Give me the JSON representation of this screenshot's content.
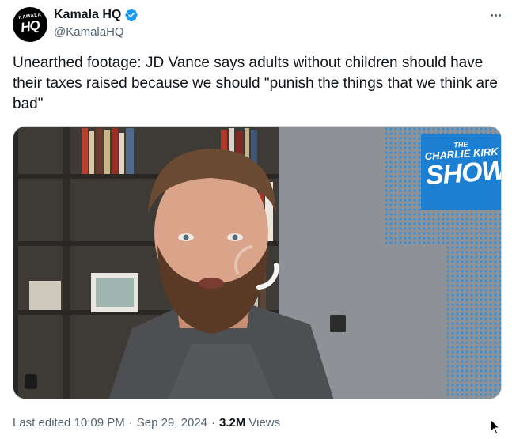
{
  "author": {
    "display_name": "Kamala HQ",
    "handle": "@KamalaHQ",
    "avatar_top_text": "KAMALA",
    "avatar_main_text": "HQ",
    "verified_color": "#1d9bf0"
  },
  "tweet": {
    "text": "Unearthed footage: JD Vance says adults without children should have their taxes raised because we should \"punish the things that we think are bad\""
  },
  "media": {
    "overlay_logo": {
      "line1": "THE",
      "line2": "CHARLIE KIRK",
      "line3": "SHOW",
      "color": "#1d7fd1"
    },
    "loading": true
  },
  "footer": {
    "edited_label": "Last edited 10:09 PM",
    "separator": "·",
    "date": "Sep 29, 2024",
    "views_count": "3.2M",
    "views_label": "Views"
  }
}
